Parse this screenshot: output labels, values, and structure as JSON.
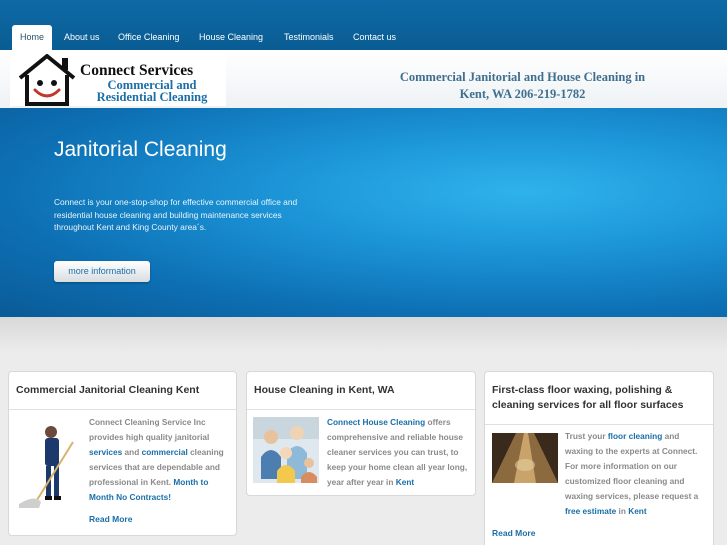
{
  "nav": {
    "items": [
      "Home",
      "About us",
      "Office Cleaning",
      "House Cleaning",
      "Testimonials",
      "Contact us"
    ]
  },
  "header": {
    "logo_title": "Connect Services",
    "logo_sub_1": "Commercial and",
    "logo_sub_2": "Residential Cleaning",
    "tagline_1": "Commercial Janitorial and House Cleaning in",
    "tagline_2": "Kent, WA 206-219-1782"
  },
  "hero": {
    "title": "Janitorial Cleaning",
    "text": "Connect is your one-stop-shop for effective commercial office and residential house cleaning and building maintenance services throughout Kent and King County area´s.",
    "button": "more information"
  },
  "cards": {
    "c1": {
      "title": "Commercial Janitorial Cleaning Kent",
      "t1": "Connect Cleaning Service Inc provides high quality janitorial",
      "l1": "services",
      "t2": "and",
      "l2": "commercial",
      "t3": "cleaning services that are dependable and professional in Kent.",
      "l3": "Month to Month No Contracts!",
      "read_more": "Read More"
    },
    "c2": {
      "title": "House Cleaning in Kent, WA",
      "l1": "Connect House Cleaning",
      "t1": "offers comprehensive and reliable house cleaner services you can trust, to keep your home clean all year long, year after year in",
      "l2": "Kent"
    },
    "c3": {
      "title": "First-class floor waxing, polishing & cleaning services for all floor surfaces",
      "t1": "Trust your",
      "l1": "floor cleaning",
      "t2": "and waxing to the experts at Connect. For more information on our customized floor cleaning and waxing services, please request a",
      "l2": "free estimate",
      "t3": "in",
      "l3": "Kent",
      "read_more": "Read More"
    }
  },
  "colors": {
    "nav_bg": "#0d6aa6",
    "link": "#1a6fa8",
    "hero_bg": "#1b93d6"
  }
}
